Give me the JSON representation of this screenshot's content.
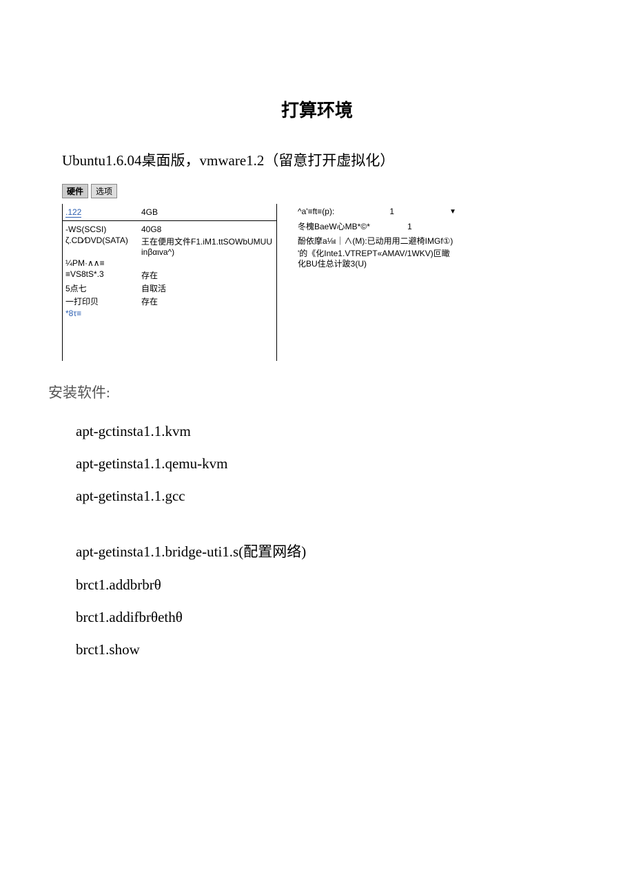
{
  "title": "打算环境",
  "subtitle": "Ubuntu1.6.04桌面版，vmware1.2（留意打开虚拟化）",
  "tabs": {
    "hardware": "硬件",
    "options": "选项"
  },
  "vm": {
    "memRow": {
      "label": ".122",
      "value": "4GB"
    },
    "rows": [
      {
        "label": "-WS(SCSI)",
        "value": "40G8",
        "labelClass": ""
      },
      {
        "label": "ζ.CD∕DVD(SATA)",
        "value": "王在便用文件F1.iM1.ttSOWbUMUUinβαιva^)",
        "labelClass": ""
      },
      {
        "label": "¼PM·∧∧≡",
        "value": "",
        "labelClass": ""
      },
      {
        "label": "≡VS8tS*.3",
        "value": "存在",
        "labelClass": ""
      },
      {
        "label": "5点七",
        "value": "自取活",
        "labelClass": ""
      },
      {
        "label": "一打印贝",
        "value": "存在",
        "labelClass": ""
      },
      {
        "label": "*8τ≡",
        "value": "",
        "labelClass": "blue"
      }
    ],
    "right": {
      "row1": {
        "label": "^a'≡ft≡(p):",
        "value": "1"
      },
      "row2": {
        "label": "冬槐BaeW心MB*©*",
        "value": "1"
      },
      "line1": "酚依摩a⅛ι｜∧(M):已动用用二避椅IMGf①)",
      "line2": "'的《化Inte1.VTREPT«AMAV/1WKV)叵瞰化BU住总计跛3(U)"
    }
  },
  "sectionLabel": "安装软件:",
  "commands": [
    "apt-gctinsta1.1.kvm",
    "apt-getinsta1.1.qemu-kvm",
    "apt-getinsta1.1.gcc",
    "",
    "apt-getinsta1.1.bridge-uti1.s(配置网络)",
    "brct1.addbrbrθ",
    "brct1.addifbrθethθ",
    "brct1.show"
  ]
}
